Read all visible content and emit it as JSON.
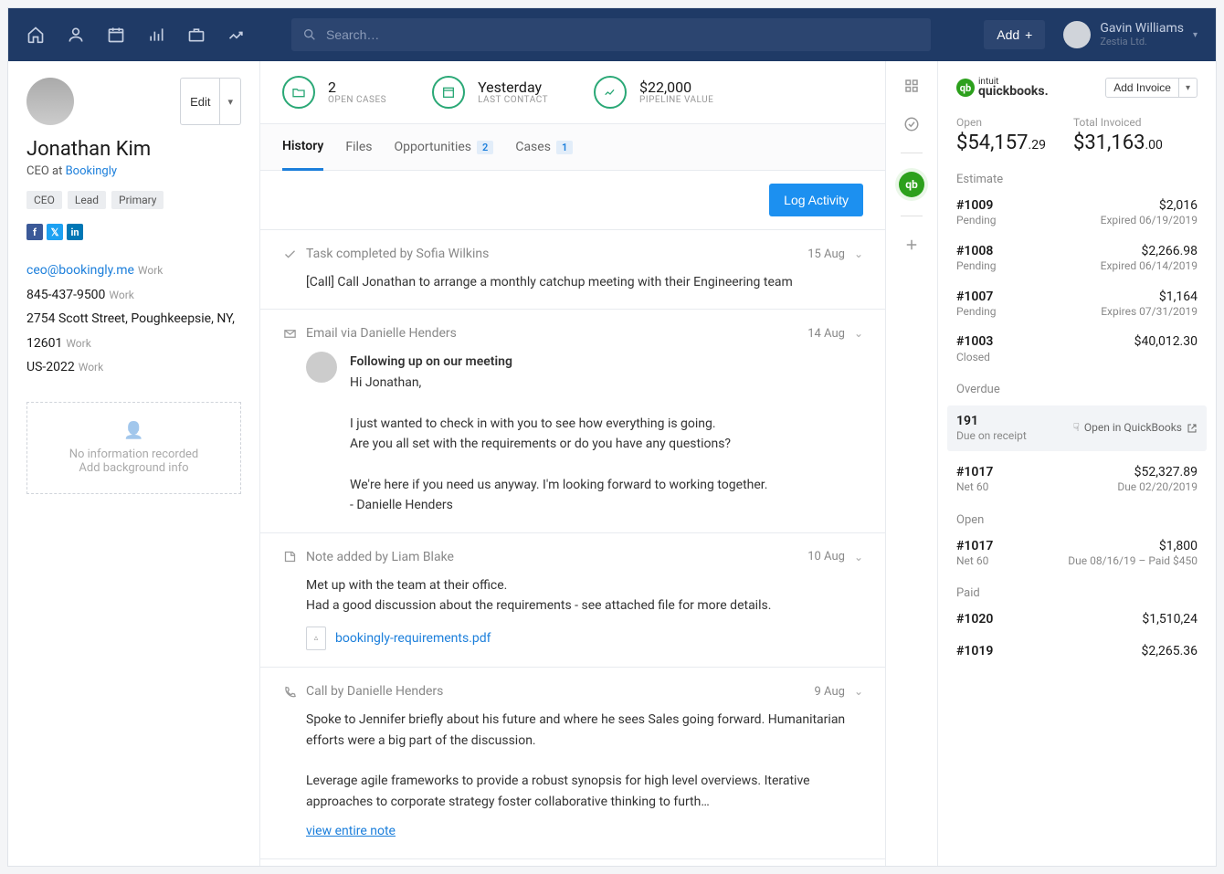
{
  "header": {
    "search_placeholder": "Search…",
    "add_label": "Add",
    "user_name": "Gavin Williams",
    "user_org": "Zestia Ltd."
  },
  "sidebar": {
    "edit_label": "Edit",
    "name": "Jonathan Kim",
    "title_prefix": "CEO at ",
    "company": "Bookingly",
    "tags": [
      "CEO",
      "Lead",
      "Primary"
    ],
    "email": "ceo@bookingly.me",
    "email_label": "Work",
    "phone": "845-437-9500",
    "phone_label": "Work",
    "address": "2754 Scott Street, Poughkeepsie, NY, 12601",
    "address_label": "Work",
    "country": "US-2022",
    "country_label": "Work",
    "no_info_1": "No information recorded",
    "no_info_2": "Add background info"
  },
  "stats": {
    "open_cases_value": "2",
    "open_cases_label": "OPEN CASES",
    "last_contact_value": "Yesterday",
    "last_contact_label": "LAST CONTACT",
    "pipeline_value": "$22,000",
    "pipeline_label": "PIPELINE VALUE"
  },
  "tabs": {
    "history": "History",
    "files": "Files",
    "opportunities": "Opportunities",
    "opportunities_count": "2",
    "cases": "Cases",
    "cases_count": "1"
  },
  "log_button": "Log Activity",
  "entries": {
    "e0": {
      "title": "Task completed by Sofia Wilkins",
      "date": "15 Aug",
      "body": "[Call] Call Jonathan to arrange a monthly catchup meeting with their Engineering team"
    },
    "e1": {
      "title": "Email via Danielle Henders",
      "date": "14 Aug",
      "subject": "Following up on our meeting",
      "greeting": "Hi Jonathan,",
      "para1": "I just wanted to check in with you to see how everything is going.",
      "para2": "Are you all set with the requirements or do you have any questions?",
      "para3": "We're here if you need us anyway. I'm looking forward to working together.",
      "signoff": "- Danielle Henders"
    },
    "e2": {
      "title": "Note added by Liam Blake",
      "date": "10 Aug",
      "line1": "Met up with the team at their office.",
      "line2": "Had a good discussion about the requirements - see attached file for more details.",
      "attachment": "bookingly-requirements.pdf"
    },
    "e3": {
      "title": "Call by Danielle Henders",
      "date": "9 Aug",
      "para1": "Spoke to Jennifer briefly about his future and where he sees Sales going forward. Humanitarian efforts were a big part of the discussion.",
      "para2": "Leverage agile frameworks to provide a robust synopsis for high level overviews. Iterative approaches to corporate strategy foster collaborative thinking to furth…",
      "view_link": "view entire note"
    }
  },
  "qb": {
    "logo_small": "intuit",
    "logo_big": "quickbooks.",
    "add_invoice": "Add Invoice",
    "open_label": "Open",
    "open_value_int": "$54,157",
    "open_value_dec": ".29",
    "total_label": "Total Invoiced",
    "total_value_int": "$31,163",
    "total_value_dec": ".00",
    "section_estimate": "Estimate",
    "section_overdue": "Overdue",
    "section_open": "Open",
    "section_paid": "Paid",
    "estimates": [
      {
        "id": "#1009",
        "status": "Pending",
        "amt": "$2,016",
        "due": "Expired 06/19/2019"
      },
      {
        "id": "#1008",
        "status": "Pending",
        "amt": "$2,266.98",
        "due": "Expired 06/14/2019"
      },
      {
        "id": "#1007",
        "status": "Pending",
        "amt": "$1,164",
        "due": "Expires 07/31/2019"
      },
      {
        "id": "#1003",
        "status": "Closed",
        "amt": "$40,012.30",
        "due": ""
      }
    ],
    "overdue": [
      {
        "id": "191",
        "status": "Due on receipt",
        "amt": "",
        "due": "Open in QuickBooks"
      },
      {
        "id": "#1017",
        "status": "Net 60",
        "amt": "$52,327.89",
        "due": "Due 02/20/2019"
      }
    ],
    "openinv": [
      {
        "id": "#1017",
        "status": "Net 60",
        "amt": "$1,800",
        "due": "Due 08/16/19 – Paid $450"
      }
    ],
    "paid": [
      {
        "id": "#1020",
        "status": "",
        "amt": "$1,510,24",
        "due": ""
      },
      {
        "id": "#1019",
        "status": "",
        "amt": "$2,265.36",
        "due": ""
      }
    ],
    "open_in_qb": "Open in QuickBooks"
  }
}
